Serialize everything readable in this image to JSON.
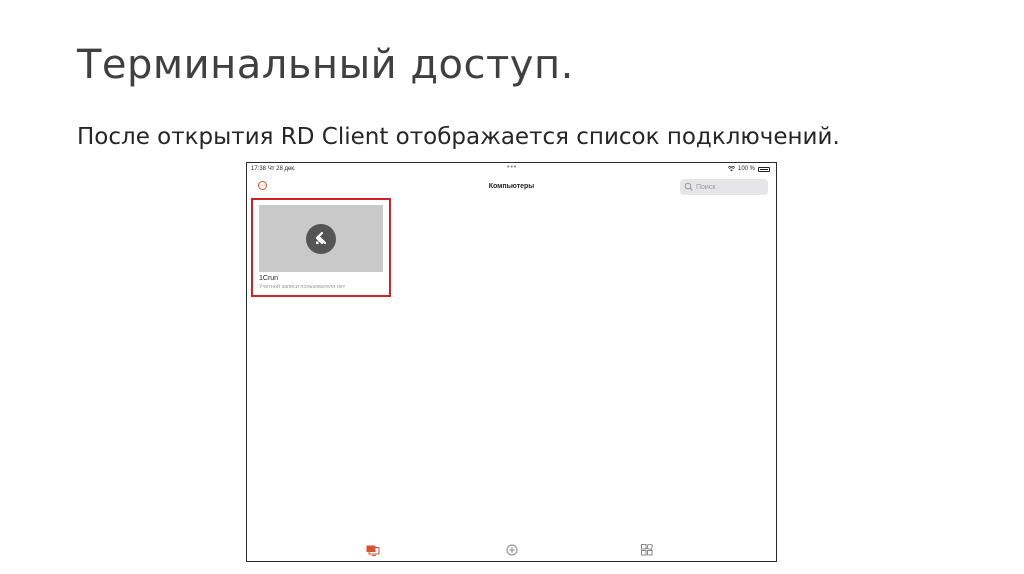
{
  "slide": {
    "title": "Терминальный доступ.",
    "body": "После открытия RD Client отображается список подключений."
  },
  "device": {
    "status": {
      "time": "17:38",
      "date": "Чт 28 дек.",
      "dots": "•••",
      "battery": "100 %"
    },
    "navbar": {
      "title": "Компьютеры",
      "more_icon": "ellipsis-circle-icon",
      "search_placeholder": "Поиск"
    },
    "connections": [
      {
        "name": "1Crun",
        "subtitle": "Учетной записи пользователя нет",
        "icon": "remote-desktop-icon"
      }
    ],
    "tabs": [
      {
        "icon": "desktops-icon",
        "active": true
      },
      {
        "icon": "add-icon",
        "active": false
      },
      {
        "icon": "apps-icon",
        "active": false
      }
    ],
    "colors": {
      "accent": "#d5532e",
      "highlight": "#d32128",
      "thumb": "#c9c9c9"
    }
  }
}
